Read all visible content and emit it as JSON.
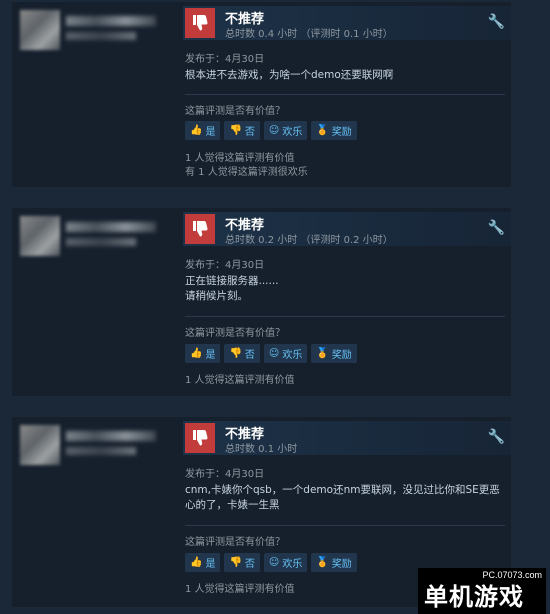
{
  "reviews": [
    {
      "verdict": "不推荐",
      "hours": "总时数 0.4 小时 （评测时 0.1 小时）",
      "posted": "发布于：4月30日",
      "body": "根本进不去游戏，为啥一个demo还要联网啊",
      "helpful_question": "这篇评测是否有价值？",
      "buttons": {
        "yes": "是",
        "no": "否",
        "funny": "欢乐",
        "award": "奖励"
      },
      "stats": [
        "1 人觉得这篇评测有价值",
        "有 1 人觉得这篇评测很欢乐"
      ]
    },
    {
      "verdict": "不推荐",
      "hours": "总时数 0.2 小时 （评测时 0.2 小时）",
      "posted": "发布于：4月30日",
      "body": "正在链接服务器......\n请稍候片刻。",
      "helpful_question": "这篇评测是否有价值？",
      "buttons": {
        "yes": "是",
        "no": "否",
        "funny": "欢乐",
        "award": "奖励"
      },
      "stats": [
        "1 人觉得这篇评测有价值"
      ]
    },
    {
      "verdict": "不推荐",
      "hours": "总时数 0.1 小时",
      "posted": "发布于：4月30日",
      "body": "cnm,卡婊你个qsb，一个demo还nm要联网，没见过比你和SE更恶心的了，卡婊一生黑",
      "helpful_question": "这篇评测是否有价值？",
      "buttons": {
        "yes": "是",
        "no": "否",
        "funny": "欢乐",
        "award": "奖励"
      },
      "stats": [
        "1 人觉得这篇评测有价值"
      ]
    }
  ],
  "watermark": {
    "url": "PC.07073.com",
    "brand": "单机游戏"
  },
  "icons": {
    "thumb_down": "thumbs-down-icon",
    "settings": "wrench-icon",
    "yes": "thumbs-up-icon",
    "no": "thumbs-down-icon",
    "funny": "smile-icon",
    "award": "award-icon"
  },
  "colors": {
    "background": "#1b2838",
    "card": "#16202d",
    "not_recommended": "#c23c3c",
    "button_text": "#67c1f5",
    "award": "#e2b84a"
  }
}
